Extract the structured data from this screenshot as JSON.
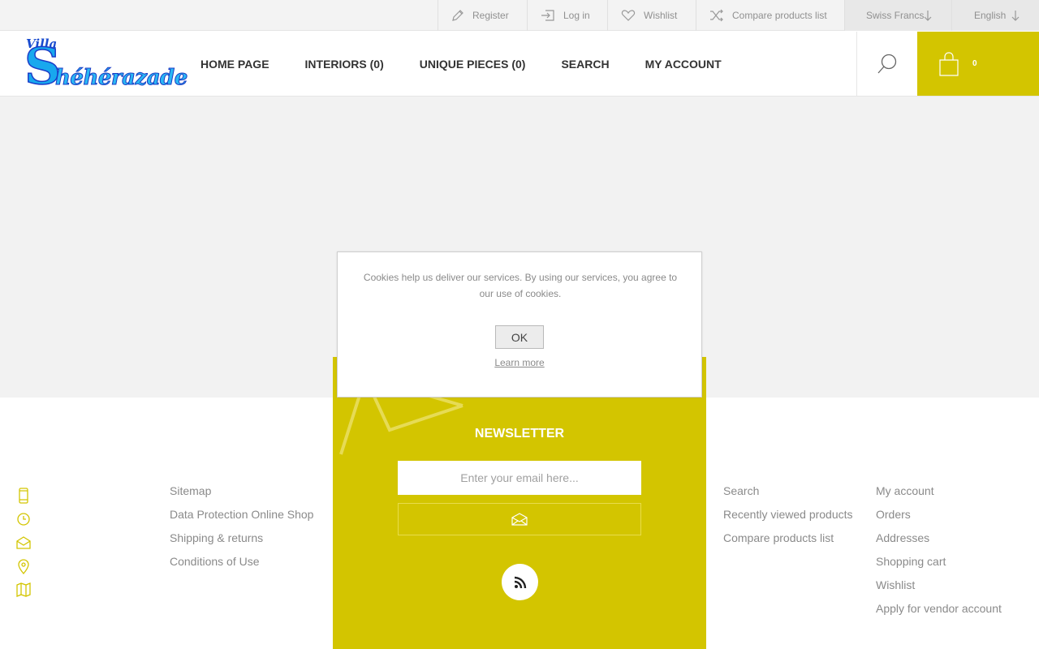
{
  "topbar": {
    "register": "Register",
    "login": "Log in",
    "wishlist": "Wishlist",
    "compare": "Compare products list",
    "currency": "Swiss Francs",
    "language": "English"
  },
  "header": {
    "logo_villa": "Villa",
    "logo_s": "S",
    "logo_rest": "héhérazade",
    "nav": [
      "HOME PAGE",
      "INTERIORS (0)",
      "UNIQUE PIECES (0)",
      "SEARCH",
      "MY ACCOUNT"
    ],
    "cart_count": "0"
  },
  "cookie": {
    "text": "Cookies help us deliver our services. By using our services, you agree to our use of cookies.",
    "ok": "OK",
    "learn_more": "Learn more"
  },
  "footer": {
    "information": [
      "Sitemap",
      "Data Protection Online Shop",
      "Shipping & returns",
      "Conditions of Use"
    ],
    "newsletter_title": "NEWSLETTER",
    "newsletter_placeholder": "Enter your email here...",
    "customer_service": [
      "Search",
      "Recently viewed products",
      "Compare products list"
    ],
    "my_account": [
      "My account",
      "Orders",
      "Addresses",
      "Shopping cart",
      "Wishlist",
      "Apply for vendor account"
    ]
  },
  "colors": {
    "accent": "#d3c500",
    "page_grey": "#f2f2f2"
  },
  "icons": [
    "pencil-icon",
    "login-icon",
    "heart-icon",
    "shuffle-icon",
    "arrow-down-icon",
    "search-icon",
    "shopping-bag-icon",
    "envelope-icon",
    "rss-icon",
    "mobile-icon",
    "clock-icon",
    "mail-icon",
    "location-icon",
    "map-icon"
  ]
}
